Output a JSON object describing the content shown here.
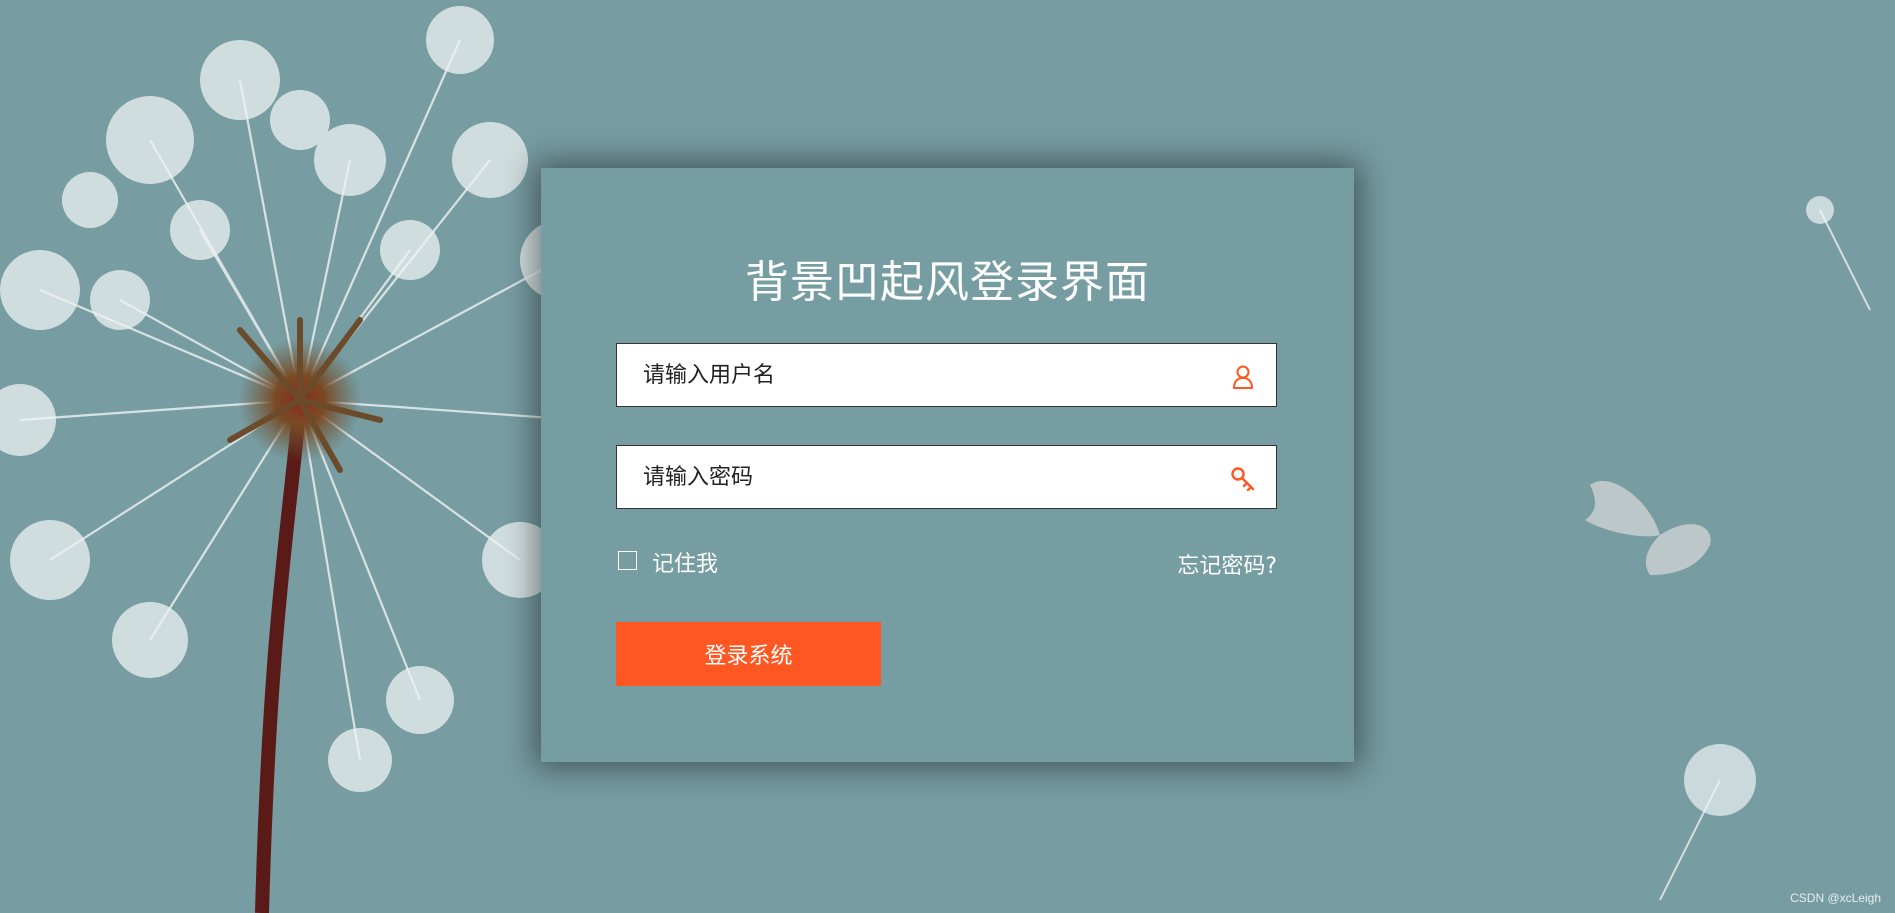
{
  "login": {
    "title": "背景凹起风登录界面",
    "username_placeholder": "请输入用户名",
    "password_placeholder": "请输入密码",
    "remember_label": "记住我",
    "forgot_label": "忘记密码?",
    "submit_label": "登录系统"
  },
  "icons": {
    "user": "user-icon",
    "password": "key-icon"
  },
  "colors": {
    "background": "#779ca2",
    "card": "#769da1",
    "accent": "#ff5722",
    "text_light": "#ffffff"
  },
  "watermark": "CSDN @xcLeigh"
}
